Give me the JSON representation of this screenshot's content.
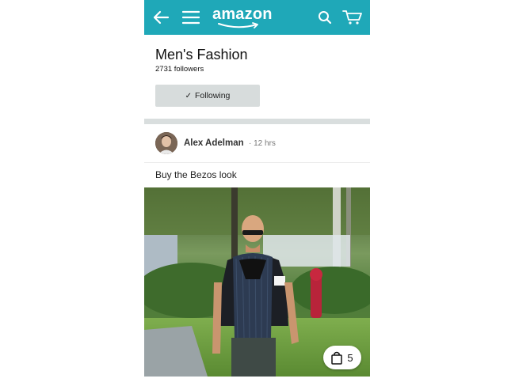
{
  "header": {
    "logo_text": "amazon",
    "bar_color": "#1fa8b8",
    "icons": [
      "back-arrow-icon",
      "hamburger-menu-icon",
      "search-icon",
      "cart-icon"
    ]
  },
  "community": {
    "title": "Men's Fashion",
    "followers": "2731 followers",
    "follow_button": "Following"
  },
  "post": {
    "author": "Alex Adelman",
    "time": "· 12 hrs",
    "caption": "Buy the Bezos look",
    "product_count": "5"
  }
}
